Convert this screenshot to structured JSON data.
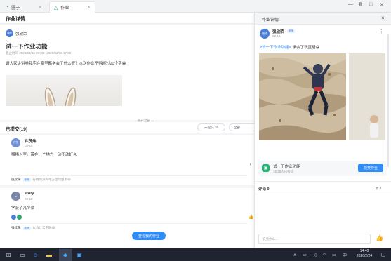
{
  "titlebar": {
    "tabs": [
      {
        "label": "圈子"
      },
      {
        "label": "作业"
      }
    ],
    "controls": [
      "—",
      "⧉",
      "□",
      "✕"
    ]
  },
  "left": {
    "header_title": "作业详情",
    "teacher": {
      "name": "强欣荣",
      "avatar_text": "强欣"
    },
    "assignment": {
      "title": "试一下作业功能",
      "deadline": "截止时间 2020/02/16 09:00 - 2020/02/16 17:00",
      "description": "请大家讲讲卷我宅在家里都学会了什么呀？本次作业不得超过20个字😀",
      "expand_label": "展开全部"
    },
    "submitted": {
      "title": "已提交(19)",
      "filter_unsubmitted": "未提交 16",
      "filter_all": "全部"
    },
    "submissions": [
      {
        "avatar_text": "许茂",
        "name": "许茂炜",
        "date": "02-16",
        "text": "稀稀入室。带在一个地方一动不动好久",
        "reply_name": "强欣荣",
        "reply_badge": "老师",
        "reply_text": "在概述没的地方运动量用😀"
      },
      {
        "avatar_text": "st",
        "name": "story",
        "date": "02-16",
        "text": "学会了几个菜",
        "reply_name": "强欣荣",
        "reply_badge": "老师",
        "reply_text": "以会计实用融😀"
      }
    ],
    "view_my_button": "查看我的作业"
  },
  "right": {
    "header_title": "作业详情",
    "close": "×",
    "more": "⋮",
    "author": {
      "name": "强欣荣",
      "badge": "老师",
      "date": "02-16",
      "avatar_text": "强欣"
    },
    "post_hashtag": "#试一下作业功能#",
    "post_text": "学会了玩直播😀",
    "assignment_card": {
      "title": "试一下作业功能",
      "meta": "16/35人已提交",
      "button": "前交作业"
    },
    "comments_label": "评论 0",
    "likes_label": "赞 0",
    "comment_placeholder": "说点什么..."
  },
  "taskbar": {
    "time": "14:40",
    "date": "2020/2/24",
    "lang": "中"
  }
}
